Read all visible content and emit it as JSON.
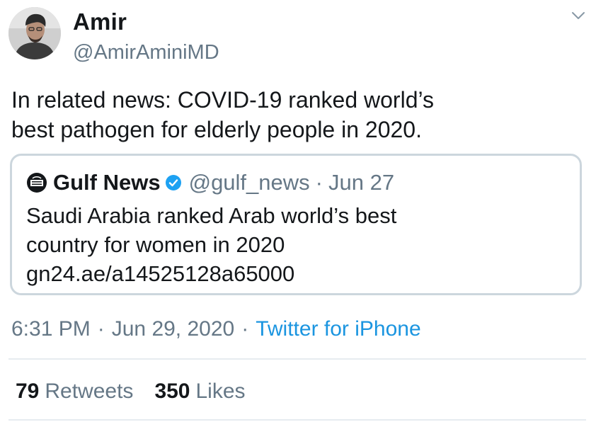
{
  "author": {
    "name": "Amir",
    "handle": "@AmirAminiMD",
    "avatar_icon": "profile-photo"
  },
  "tweet": {
    "text_lines": [
      "In related news: COVID-19 ranked world’s",
      "best pathogen for elderly people in 2020."
    ]
  },
  "quoted_tweet": {
    "name": "Gulf News",
    "handle": "@gulf_news",
    "separator": "·",
    "date": "Jun 27",
    "verified": true,
    "body_lines": [
      "Saudi Arabia ranked Arab world’s best",
      "country for women in 2020",
      "gn24.ae/a14525128a65000"
    ]
  },
  "meta": {
    "time": "6:31 PM",
    "separator": "·",
    "date": "Jun 29, 2020",
    "source": "Twitter for iPhone"
  },
  "stats": {
    "retweets_count": "79",
    "retweets_label": "Retweets",
    "likes_count": "350",
    "likes_label": "Likes"
  },
  "colors": {
    "primary_text": "#14171a",
    "secondary_text": "#657786",
    "link": "#1b95e0",
    "border": "#ccd6dd",
    "divider": "#e6ecf0",
    "verified_badge": "#1da1f2"
  }
}
